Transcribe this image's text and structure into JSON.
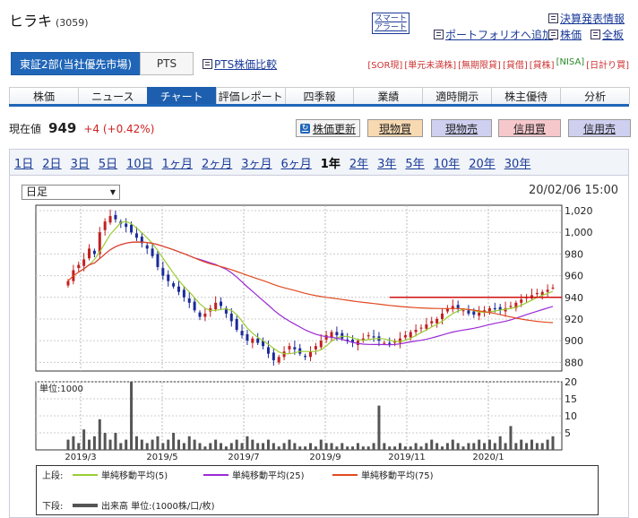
{
  "header": {
    "company": "ヒラキ",
    "code": "(3059)",
    "smart_alert": "スマート\nアラート",
    "links": [
      "決算発表情報",
      "ポートフォリオへ追加",
      "株価",
      "全板"
    ]
  },
  "market_tabs": [
    "東証2部(当社優先市場)",
    "PTS"
  ],
  "pts_compare": "PTS株価比較",
  "tags": [
    "[SOR現]",
    "[単元未満株]",
    "[無期限貸]",
    "[貸借]",
    "[貸株]",
    "[NISA]",
    "[日計り買]"
  ],
  "nav": [
    "株価",
    "ニュース",
    "チャート",
    "評価レポート",
    "四季報",
    "業績",
    "適時開示",
    "株主優待",
    "分析"
  ],
  "nav_active": "チャート",
  "price": {
    "label": "現在値",
    "value": "949",
    "change": "+4 (+0.42%)"
  },
  "buttons": {
    "refresh": "株価更新",
    "buy": "現物買",
    "sell": "現物売",
    "margin_buy": "信用買",
    "margin_sell": "信用売"
  },
  "periods": [
    "1日",
    "2日",
    "3日",
    "5日",
    "10日",
    "1ヶ月",
    "2ヶ月",
    "3ヶ月",
    "6ヶ月",
    "1年",
    "2年",
    "3年",
    "5年",
    "10年",
    "20年",
    "30年"
  ],
  "period_active": "1年",
  "select_value": "日足",
  "timestamp": "20/02/06 15:00",
  "colors": {
    "up": "#c02020",
    "down": "#1a2a9a",
    "ma5": "#9acd32",
    "ma25": "#9a2ad4",
    "ma75": "#e04a20",
    "volume": "#555555",
    "hline": "#d01010"
  },
  "chart_data": {
    "type": "candlestick",
    "price_axis": {
      "ticks": [
        "1,020",
        "1,000",
        "980",
        "960",
        "940",
        "920",
        "900",
        "880"
      ],
      "ylim": [
        872,
        1025
      ]
    },
    "x_ticks": [
      "2019/3",
      "2019/5",
      "2019/7",
      "2019/9",
      "2019/11",
      "2020/1"
    ],
    "volume_axis": {
      "label": "単位:1000",
      "ticks": [
        "20",
        "15",
        "10",
        "5"
      ],
      "ylim": [
        0,
        20
      ]
    },
    "horizontal_line": 940,
    "close_series": [
      955,
      965,
      970,
      975,
      985,
      980,
      1000,
      1010,
      1015,
      1012,
      1008,
      1005,
      1000,
      995,
      990,
      985,
      978,
      968,
      960,
      955,
      950,
      945,
      940,
      935,
      928,
      922,
      925,
      930,
      935,
      932,
      925,
      918,
      910,
      905,
      900,
      902,
      898,
      895,
      888,
      882,
      885,
      890,
      895,
      892,
      888,
      885,
      890,
      895,
      900,
      905,
      908,
      905,
      902,
      900,
      898,
      900,
      902,
      905,
      903,
      900,
      898,
      897,
      899,
      902,
      905,
      908,
      910,
      912,
      915,
      918,
      920,
      925,
      930,
      932,
      930,
      928,
      925,
      924,
      926,
      928,
      930,
      929,
      928,
      930,
      932,
      935,
      938,
      940,
      942,
      944,
      945,
      947,
      949
    ],
    "volume_series": [
      3,
      4,
      2,
      6,
      3,
      4,
      9,
      5,
      3,
      5,
      2,
      3,
      20,
      4,
      3,
      2,
      3,
      4,
      2,
      3,
      5,
      3,
      2,
      4,
      3,
      2,
      1,
      2,
      3,
      2,
      1,
      2,
      3,
      2,
      4,
      3,
      2,
      2,
      3,
      2,
      1,
      2,
      3,
      2,
      1,
      1,
      2,
      1,
      3,
      2,
      2,
      1,
      2,
      1,
      1,
      2,
      1,
      1,
      2,
      13,
      2,
      1,
      1,
      2,
      1,
      1,
      2,
      1,
      2,
      3,
      2,
      1,
      2,
      3,
      2,
      1,
      2,
      2,
      3,
      2,
      3,
      2,
      4,
      2,
      7,
      2,
      3,
      2,
      3,
      2,
      2,
      3,
      4
    ],
    "legend": {
      "upper_label": "上段:",
      "lower_label": "下段:",
      "ma5": "単純移動平均(5)",
      "ma25": "単純移動平均(25)",
      "ma75": "単純移動平均(75)",
      "volume": "出来高 単位:(1000株/口/枚)"
    }
  }
}
